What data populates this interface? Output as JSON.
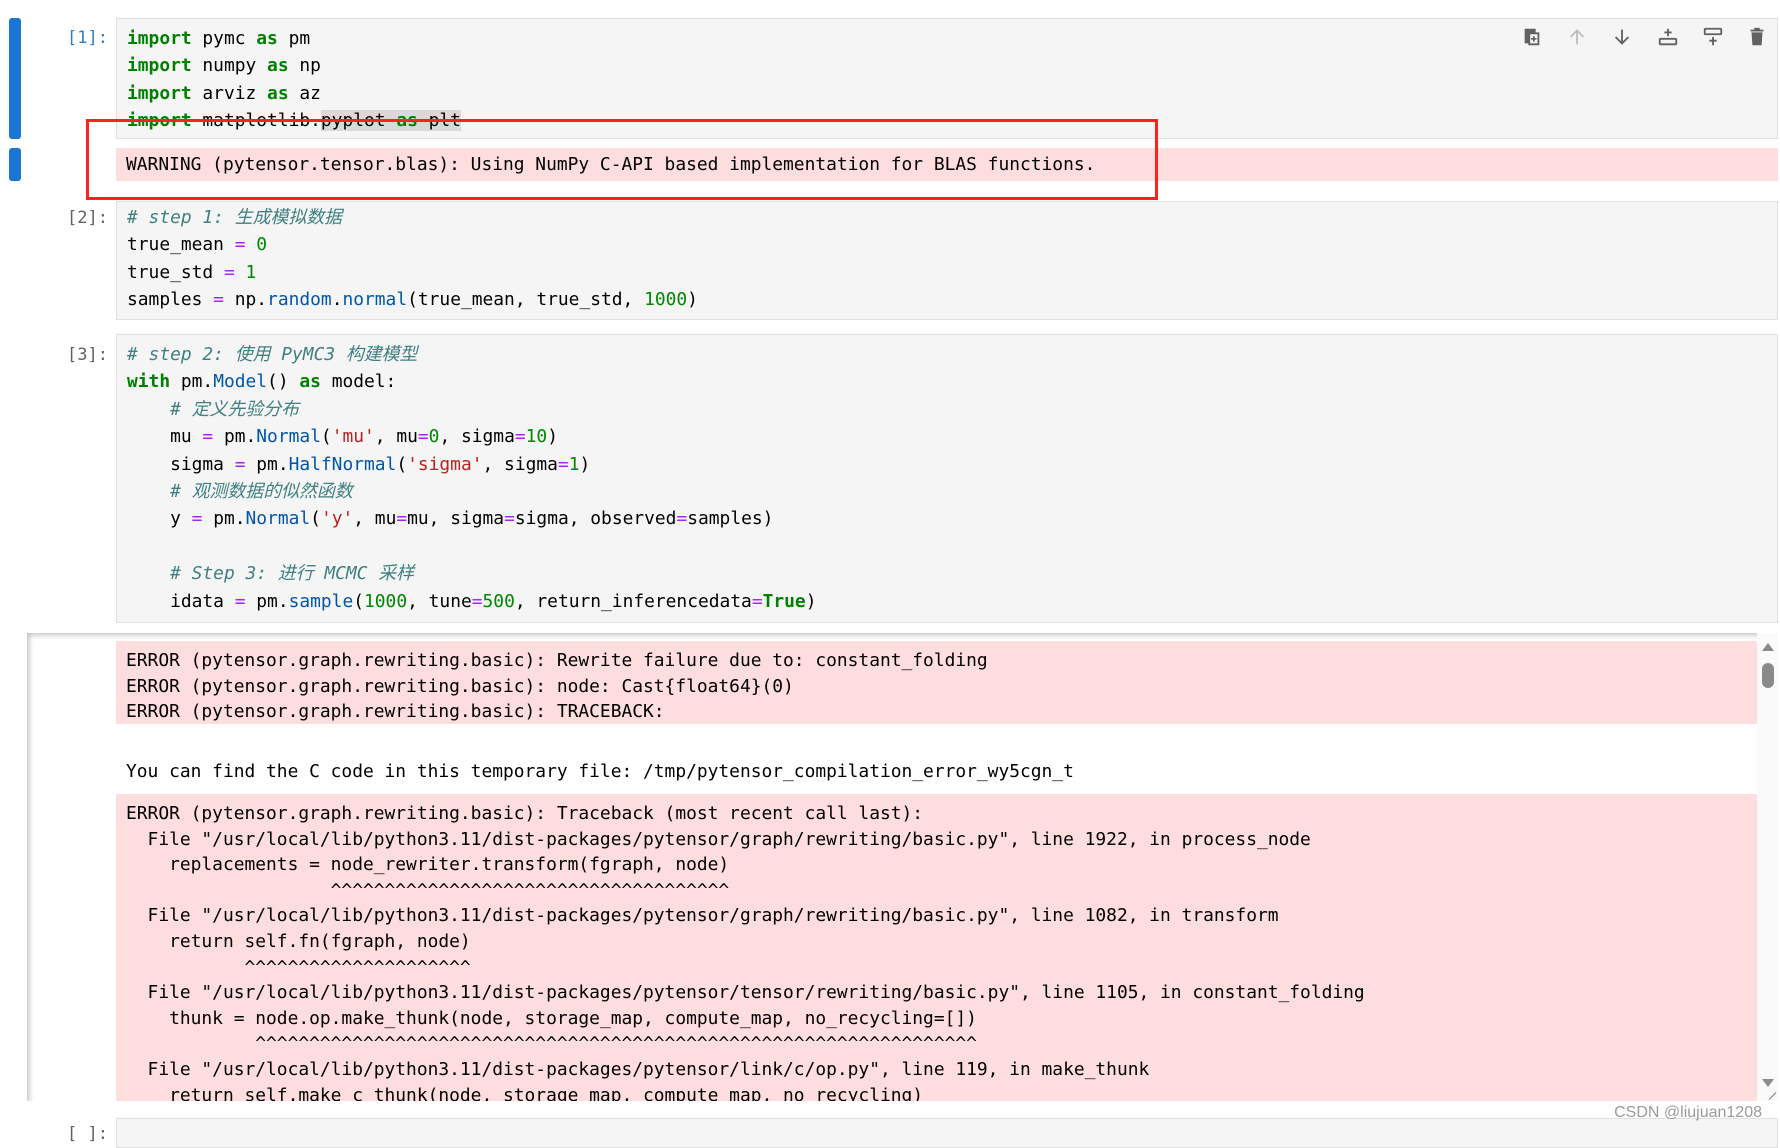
{
  "colors": {
    "active_bar": "#1976d2",
    "stderr_bg": "#fddddd",
    "annotation_box": "#ff2020",
    "keyword": "#008000",
    "string": "#ba2121",
    "operator": "#aa22ff",
    "property": "#0055aa",
    "comment": "#408080"
  },
  "toolbar": {
    "icons": [
      "duplicate-cell-icon",
      "move-up-icon",
      "move-down-icon",
      "insert-above-icon",
      "insert-below-icon",
      "delete-cell-icon"
    ]
  },
  "cells": [
    {
      "prompt": "[1]:",
      "lines": [
        [
          {
            "t": "import",
            "c": "kw"
          },
          {
            "t": " pymc "
          },
          {
            "t": "as",
            "c": "kw"
          },
          {
            "t": " pm"
          }
        ],
        [
          {
            "t": "import",
            "c": "kw"
          },
          {
            "t": " numpy "
          },
          {
            "t": "as",
            "c": "kw"
          },
          {
            "t": " np"
          }
        ],
        [
          {
            "t": "import",
            "c": "kw"
          },
          {
            "t": " arviz "
          },
          {
            "t": "as",
            "c": "kw"
          },
          {
            "t": " az"
          }
        ],
        [
          {
            "t": "import",
            "c": "kw"
          },
          {
            "t": " matplotlib."
          },
          {
            "t": "pyplot ",
            "c": "sel"
          },
          {
            "t": "as",
            "c": "kw sel"
          },
          {
            "t": " plt",
            "c": "sel"
          }
        ]
      ],
      "output": [
        "WARNING (pytensor.tensor.blas): Using NumPy C-API based implementation for BLAS functions."
      ]
    },
    {
      "prompt": "[2]:",
      "lines": [
        [
          {
            "t": "# step 1: 生成模拟数据",
            "c": "cm"
          }
        ],
        [
          {
            "t": "true_mean "
          },
          {
            "t": "=",
            "c": "op"
          },
          {
            "t": " "
          },
          {
            "t": "0",
            "c": "num"
          }
        ],
        [
          {
            "t": "true_std "
          },
          {
            "t": "=",
            "c": "op"
          },
          {
            "t": " "
          },
          {
            "t": "1",
            "c": "num"
          }
        ],
        [
          {
            "t": "samples "
          },
          {
            "t": "=",
            "c": "op"
          },
          {
            "t": " np."
          },
          {
            "t": "random",
            "c": "prop"
          },
          {
            "t": "."
          },
          {
            "t": "normal",
            "c": "prop"
          },
          {
            "t": "(true_mean, true_std, "
          },
          {
            "t": "1000",
            "c": "num"
          },
          {
            "t": ")"
          }
        ]
      ]
    },
    {
      "prompt": "[3]:",
      "lines": [
        [
          {
            "t": "# step 2: 使用 PyMC3 构建模型",
            "c": "cm"
          }
        ],
        [
          {
            "t": "with",
            "c": "kw"
          },
          {
            "t": " pm."
          },
          {
            "t": "Model",
            "c": "prop"
          },
          {
            "t": "() "
          },
          {
            "t": "as",
            "c": "kw"
          },
          {
            "t": " model:"
          }
        ],
        [
          {
            "t": "    "
          },
          {
            "t": "# 定义先验分布",
            "c": "cm"
          }
        ],
        [
          {
            "t": "    mu "
          },
          {
            "t": "=",
            "c": "op"
          },
          {
            "t": " pm."
          },
          {
            "t": "Normal",
            "c": "prop"
          },
          {
            "t": "("
          },
          {
            "t": "'mu'",
            "c": "str"
          },
          {
            "t": ", mu"
          },
          {
            "t": "=",
            "c": "op"
          },
          {
            "t": "0",
            "c": "num"
          },
          {
            "t": ", sigma"
          },
          {
            "t": "=",
            "c": "op"
          },
          {
            "t": "10",
            "c": "num"
          },
          {
            "t": ")"
          }
        ],
        [
          {
            "t": "    sigma "
          },
          {
            "t": "=",
            "c": "op"
          },
          {
            "t": " pm."
          },
          {
            "t": "HalfNormal",
            "c": "prop"
          },
          {
            "t": "("
          },
          {
            "t": "'sigma'",
            "c": "str"
          },
          {
            "t": ", sigma"
          },
          {
            "t": "=",
            "c": "op"
          },
          {
            "t": "1",
            "c": "num"
          },
          {
            "t": ")"
          }
        ],
        [
          {
            "t": "    "
          },
          {
            "t": "# 观测数据的似然函数",
            "c": "cm"
          }
        ],
        [
          {
            "t": "    y "
          },
          {
            "t": "=",
            "c": "op"
          },
          {
            "t": " pm."
          },
          {
            "t": "Normal",
            "c": "prop"
          },
          {
            "t": "("
          },
          {
            "t": "'y'",
            "c": "str"
          },
          {
            "t": ", mu"
          },
          {
            "t": "=",
            "c": "op"
          },
          {
            "t": "mu, sigma"
          },
          {
            "t": "=",
            "c": "op"
          },
          {
            "t": "sigma, observed"
          },
          {
            "t": "=",
            "c": "op"
          },
          {
            "t": "samples)"
          }
        ],
        [
          {
            "t": " "
          }
        ],
        [
          {
            "t": "    "
          },
          {
            "t": "# Step 3: 进行 MCMC 采样",
            "c": "cm"
          }
        ],
        [
          {
            "t": "    idata "
          },
          {
            "t": "=",
            "c": "op"
          },
          {
            "t": " pm."
          },
          {
            "t": "sample",
            "c": "prop"
          },
          {
            "t": "("
          },
          {
            "t": "1000",
            "c": "num"
          },
          {
            "t": ", tune"
          },
          {
            "t": "=",
            "c": "op"
          },
          {
            "t": "500",
            "c": "num"
          },
          {
            "t": ", return_inferencedata"
          },
          {
            "t": "=",
            "c": "op"
          },
          {
            "t": "True",
            "c": "kw"
          },
          {
            "t": ")"
          }
        ]
      ],
      "output_blocks": [
        {
          "stderr": true,
          "lines": [
            "ERROR (pytensor.graph.rewriting.basic): Rewrite failure due to: constant_folding",
            "ERROR (pytensor.graph.rewriting.basic): node: Cast{float64}(0)",
            "ERROR (pytensor.graph.rewriting.basic): TRACEBACK:"
          ]
        },
        {
          "stderr": false,
          "lines": [
            "You can find the C code in this temporary file: /tmp/pytensor_compilation_error_wy5cgn_t"
          ]
        },
        {
          "stderr": true,
          "lines": [
            "ERROR (pytensor.graph.rewriting.basic): Traceback (most recent call last):",
            "  File \"/usr/local/lib/python3.11/dist-packages/pytensor/graph/rewriting/basic.py\", line 1922, in process_node",
            "    replacements = node_rewriter.transform(fgraph, node)",
            "                   ^^^^^^^^^^^^^^^^^^^^^^^^^^^^^^^^^^^^^",
            "  File \"/usr/local/lib/python3.11/dist-packages/pytensor/graph/rewriting/basic.py\", line 1082, in transform",
            "    return self.fn(fgraph, node)",
            "           ^^^^^^^^^^^^^^^^^^^^^",
            "  File \"/usr/local/lib/python3.11/dist-packages/pytensor/tensor/rewriting/basic.py\", line 1105, in constant_folding",
            "    thunk = node.op.make_thunk(node, storage_map, compute_map, no_recycling=[])",
            "            ^^^^^^^^^^^^^^^^^^^^^^^^^^^^^^^^^^^^^^^^^^^^^^^^^^^^^^^^^^^^^^^^^^^",
            "  File \"/usr/local/lib/python3.11/dist-packages/pytensor/link/c/op.py\", line 119, in make_thunk",
            "    return self.make_c_thunk(node, storage_map, compute_map, no_recycling)"
          ]
        }
      ]
    },
    {
      "prompt": "[ ]:"
    }
  ],
  "watermark": "CSDN @liujuan1208"
}
